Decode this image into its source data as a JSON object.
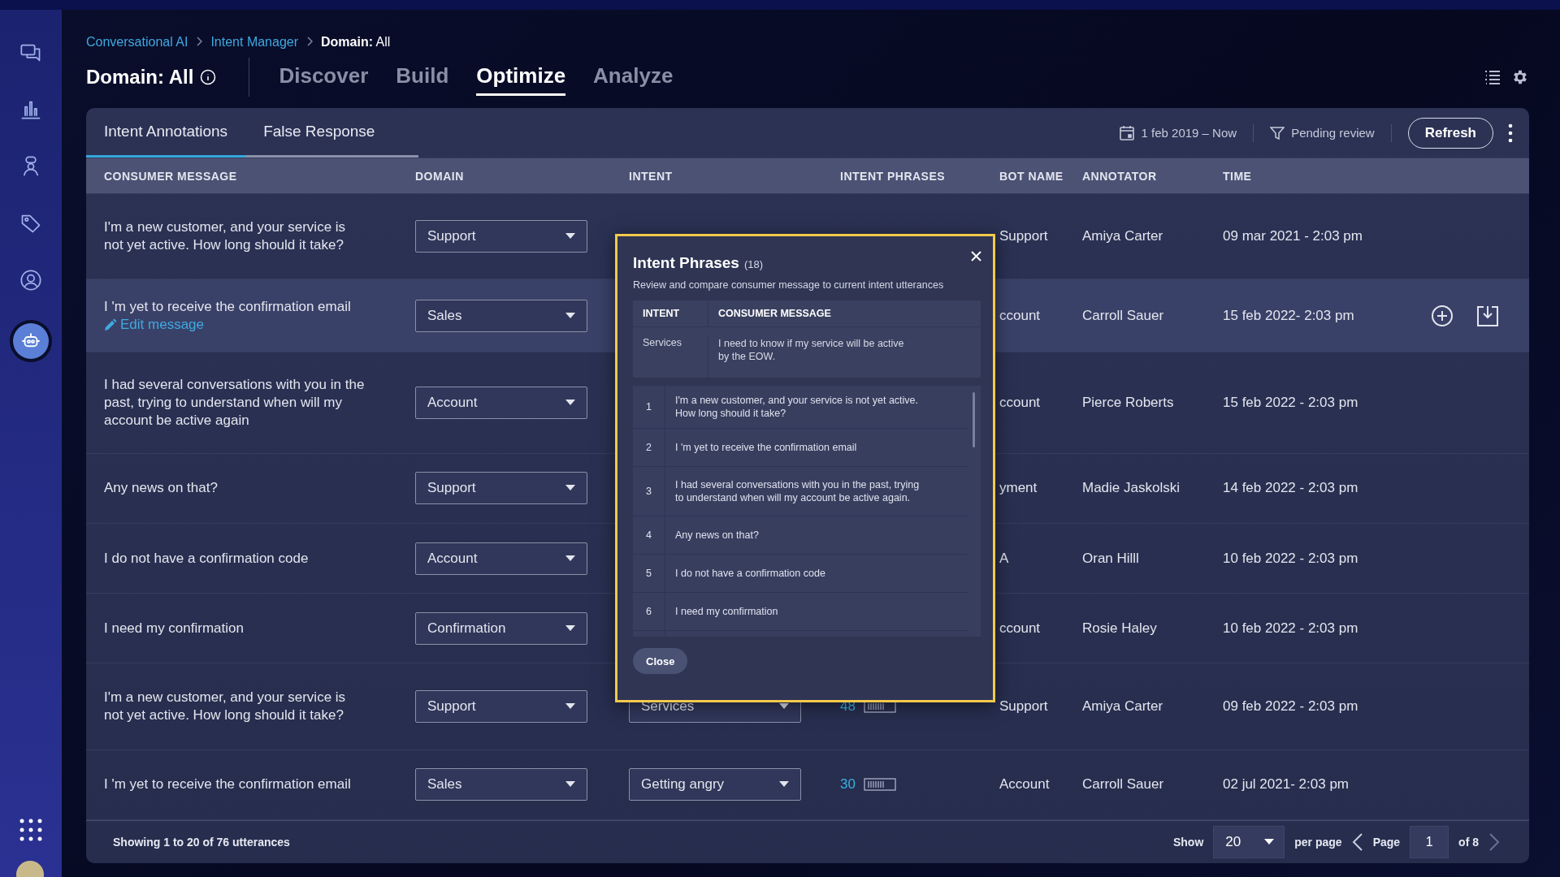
{
  "sidebar": {
    "items": [
      {
        "selected": false
      },
      {
        "selected": false
      },
      {
        "selected": false
      },
      {
        "selected": false
      },
      {
        "selected": false
      },
      {
        "selected": true
      }
    ]
  },
  "breadcrumb": [
    {
      "label": "Conversational AI",
      "kind": "link"
    },
    {
      "label": "Intent Manager",
      "kind": "link"
    },
    {
      "label": "**Domain:** All",
      "kind": "current"
    }
  ],
  "page_title": "Domain: All",
  "nav_tabs": [
    {
      "label": "Discover",
      "selected": false
    },
    {
      "label": "Build",
      "selected": false
    },
    {
      "label": "Optimize",
      "selected": true
    },
    {
      "label": "Analyze",
      "selected": false
    }
  ],
  "sub_tabs": [
    {
      "label": "Intent Annotations",
      "selected": true
    },
    {
      "label": "False Response",
      "selected": false
    }
  ],
  "date_range": "1 feb 2019  – Now",
  "filter": "Pending review",
  "refresh_button": "Refresh",
  "table": {
    "columns": [
      "CONSUMER MESSAGE",
      "DOMAIN",
      "INTENT",
      "INTENT PHRASES",
      "BOT NAME",
      "ANNOTATOR",
      "TIME"
    ],
    "rows": [
      {
        "selected": false,
        "message": "I'm a new customer, and your service is not yet active. How long should it take?",
        "domain": "Support",
        "bot_name": "Support",
        "annotator": "Amiya Carter",
        "time": "09 mar 2021 - 2:03 pm"
      },
      {
        "selected": true,
        "message": "I 'm yet to receive the confirmation email",
        "edit_link": "Edit message",
        "domain": "Sales",
        "bot_name": "ccount",
        "annotator": "Carroll Sauer",
        "time": "15 feb 2022- 2:03 pm"
      },
      {
        "selected": false,
        "message": "I had several conversations with you in the past, trying to understand when will my account be active again",
        "domain": "Account",
        "bot_name": "ccount",
        "annotator": "Pierce Roberts",
        "time": "15 feb 2022 - 2:03 pm"
      },
      {
        "selected": false,
        "message": "Any news on that?",
        "domain": "Support",
        "bot_name": "yment",
        "annotator": "Madie Jaskolski",
        "time": "14 feb 2022 - 2:03 pm"
      },
      {
        "selected": false,
        "message": "I do not have a confirmation code",
        "domain": "Account",
        "bot_name": "A",
        "annotator": "Oran Hilll",
        "time": "10 feb 2022 - 2:03 pm"
      },
      {
        "selected": false,
        "message": "I need my confirmation",
        "domain": "Confirmation",
        "bot_name": "ccount",
        "annotator": "Rosie Haley",
        "time": "10 feb 2022 - 2:03 pm"
      },
      {
        "selected": false,
        "message": "I'm a new customer, and your service is not yet active. How long should it take?",
        "domain": "Support",
        "intent": "Services",
        "phrases": "48",
        "bot_name": "Support",
        "annotator": "Amiya Carter",
        "time": "09 feb 2022 - 2:03 pm"
      },
      {
        "selected": false,
        "message": "I 'm yet to receive the confirmation email",
        "domain": "Sales",
        "intent": "Getting angry",
        "phrases": "30",
        "bot_name": "Account",
        "annotator": "Carroll Sauer",
        "time": "02 jul 2021- 2:03 pm"
      }
    ]
  },
  "footer": {
    "summary": "Showing 1 to 20 of 76 utterances",
    "show_label": "Show",
    "page_size": "20",
    "per_page": "per page",
    "page_label": "Page",
    "page": "1",
    "of_pages": "of 8"
  },
  "dialog": {
    "title": "Intent Phrases",
    "count": "(18)",
    "subtitle": "Review and compare consumer message to current intent utterances",
    "columns": [
      "INTENT",
      "CONSUMER MESSAGE"
    ],
    "reference": {
      "intent": "Services",
      "message": "I need to know if my service will be active by the EOW."
    },
    "phrases": [
      {
        "number": "1",
        "text": "I'm a new customer, and your service is not yet active. How long should it take?"
      },
      {
        "number": "2",
        "text": "I 'm yet to receive the confirmation email"
      },
      {
        "number": "3",
        "text": "I had several conversations with you in the past, trying to understand when will my account be active again."
      },
      {
        "number": "4",
        "text": "Any news on that?"
      },
      {
        "number": "5",
        "text": "I do not have a confirmation code"
      },
      {
        "number": "6",
        "text": "I need my confirmation"
      }
    ],
    "close_button": "Close"
  }
}
